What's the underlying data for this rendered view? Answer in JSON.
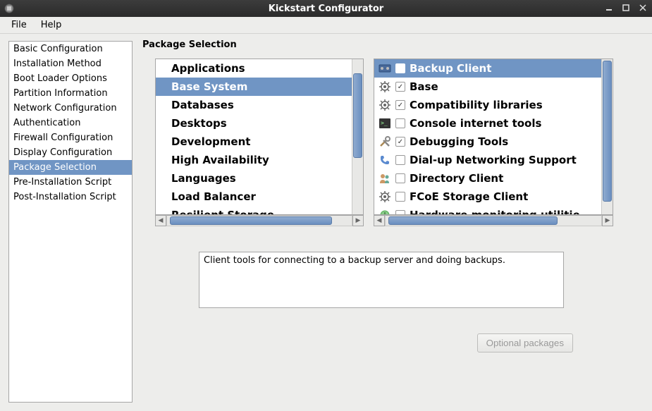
{
  "title": "Kickstart Configurator",
  "menubar": [
    "File",
    "Help"
  ],
  "sidebar": {
    "items": [
      "Basic Configuration",
      "Installation Method",
      "Boot Loader Options",
      "Partition Information",
      "Network Configuration",
      "Authentication",
      "Firewall Configuration",
      "Display Configuration",
      "Package Selection",
      "Pre-Installation Script",
      "Post-Installation Script"
    ],
    "selected": 8
  },
  "main": {
    "title": "Package Selection",
    "categories": [
      "Applications",
      "Base System",
      "Databases",
      "Desktops",
      "Development",
      "High Availability",
      "Languages",
      "Load Balancer",
      "Resilient Storage"
    ],
    "categories_selected": 1,
    "packages": [
      {
        "icon": "backup-icon",
        "checked": false,
        "label": "Backup Client",
        "selected": true
      },
      {
        "icon": "gear-icon",
        "checked": true,
        "label": "Base"
      },
      {
        "icon": "gear-icon",
        "checked": true,
        "label": "Compatibility libraries"
      },
      {
        "icon": "terminal-icon",
        "checked": false,
        "label": "Console internet tools"
      },
      {
        "icon": "tools-icon",
        "checked": true,
        "label": "Debugging Tools"
      },
      {
        "icon": "phone-icon",
        "checked": false,
        "label": "Dial-up Networking Support"
      },
      {
        "icon": "users-icon",
        "checked": false,
        "label": "Directory Client"
      },
      {
        "icon": "gear-icon",
        "checked": false,
        "label": "FCoE Storage Client"
      },
      {
        "icon": "monitor-icon",
        "checked": false,
        "label": "Hardware monitoring utilitie"
      }
    ],
    "description": "Client tools for connecting to a backup server and doing backups.",
    "optional_btn": "Optional packages"
  }
}
